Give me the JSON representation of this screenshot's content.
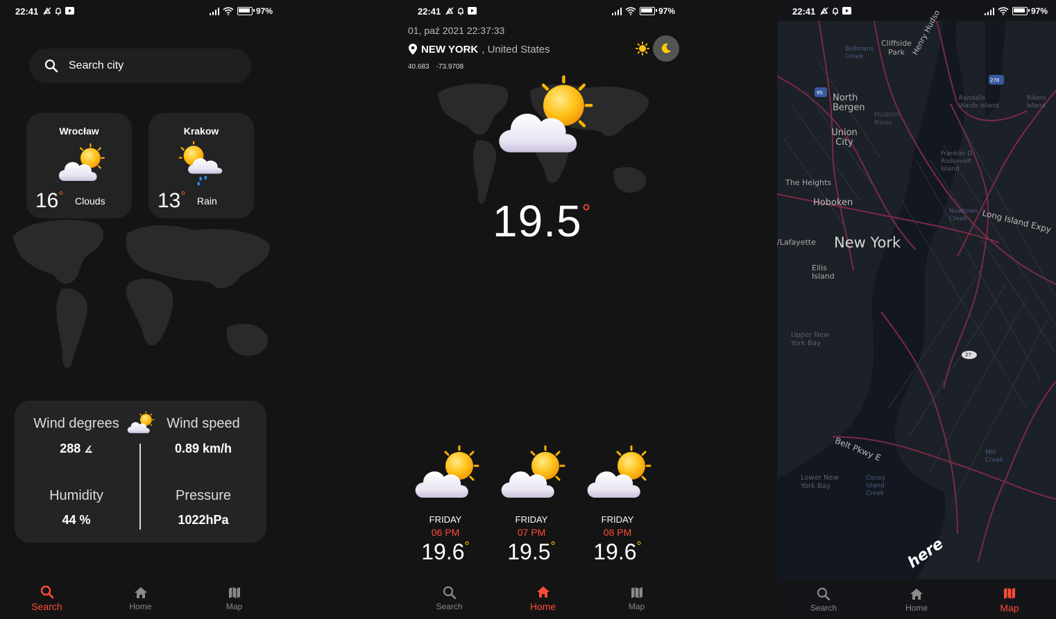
{
  "status": {
    "time": "22:41",
    "battery": "97%"
  },
  "nav": {
    "search": "Search",
    "home": "Home",
    "map": "Map"
  },
  "search_screen": {
    "search_placeholder": "Search city",
    "cities": [
      {
        "name": "Wrocław",
        "temp": "16",
        "desc": "Clouds",
        "icon": "sun-behind-cloud-icon"
      },
      {
        "name": "Krakow",
        "temp": "13",
        "desc": "Rain",
        "icon": "sun-cloud-rain-icon"
      }
    ],
    "info": {
      "wind_degrees_label": "Wind degrees",
      "wind_degrees_value": "288",
      "wind_speed_label": "Wind speed",
      "wind_speed_value": "0.89 km/h",
      "humidity_label": "Humidity",
      "humidity_value": "44 %",
      "pressure_label": "Pressure",
      "pressure_value": "1022hPa"
    }
  },
  "home_screen": {
    "datetime": "01, paź 2021 22:37:33",
    "city": "NEW YORK",
    "country": ", United States",
    "lat": "40.683",
    "lon": "-73.9708",
    "temp": "19.5",
    "forecast": [
      {
        "day": "FRIDAY",
        "hour": "06 PM",
        "temp": "19.6"
      },
      {
        "day": "FRIDAY",
        "hour": "07 PM",
        "temp": "19.5"
      },
      {
        "day": "FRIDAY",
        "hour": "08 PM",
        "temp": "19.6"
      }
    ]
  },
  "map_screen": {
    "labels": [
      "New York",
      "Hoboken",
      "North Bergen",
      "Union City",
      "Cliffside Park",
      "The Heights",
      "Ellis Island",
      "Upper New York Bay",
      "Lower New York Bay",
      "Long Island Expy",
      "Belt Pkwy E",
      "Henry Hudso",
      "Hudson River",
      "Franklin D Roosevelt Island",
      "Randalls Wards Island",
      "Rikers Island",
      "Newtown Creek",
      "Coney Island Creek",
      "Mill Creek",
      "/Lafayette",
      "Bellmans Creek"
    ],
    "badges": [
      "95",
      "278",
      "27"
    ],
    "watermark": "here"
  },
  "colors": {
    "accent": "#ff4b36",
    "bg": "#141414",
    "card": "#232323",
    "sun": "#ffcc00"
  }
}
